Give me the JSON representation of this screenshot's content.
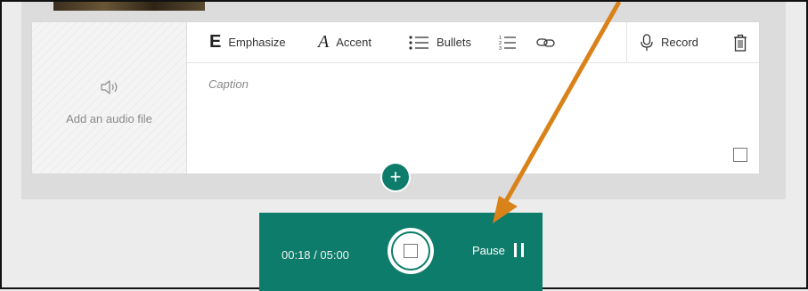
{
  "editor": {
    "audio": {
      "icon": "speaker-icon",
      "label": "Add an audio file"
    },
    "toolbar": {
      "emphasize": {
        "glyph": "E",
        "label": "Emphasize"
      },
      "accent": {
        "glyph": "A",
        "label": "Accent"
      },
      "bullets": {
        "label": "Bullets"
      },
      "numbered": {
        "icon": "numbered-list-icon"
      },
      "link": {
        "icon": "link-icon"
      },
      "record": {
        "label": "Record"
      },
      "delete": {
        "icon": "trash-icon"
      }
    },
    "caption_placeholder": "Caption",
    "add_button": "+"
  },
  "recorder": {
    "time": "00:18 / 05:00",
    "pause_label": "Pause"
  },
  "annotation": {
    "arrow_color": "#d9821a"
  },
  "colors": {
    "accent": "#0e7c6b"
  }
}
